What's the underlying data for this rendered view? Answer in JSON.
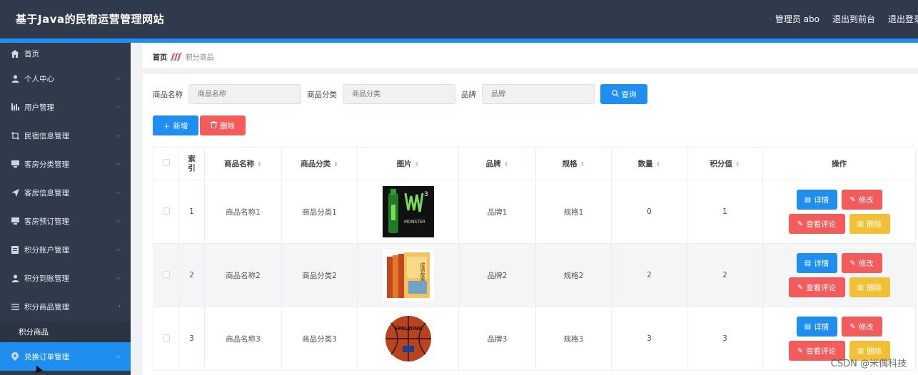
{
  "app": {
    "title": "基于Java的民宿运营管理网站",
    "user_label": "管理员 abo",
    "back_front": "退出到前台",
    "logout": "退出登录"
  },
  "sidebar": {
    "items": [
      {
        "label": "首页",
        "icon": "home-icon"
      },
      {
        "label": "个人中心",
        "icon": "user-icon"
      },
      {
        "label": "用户管理",
        "icon": "bar-chart-icon"
      },
      {
        "label": "民宿信息管理",
        "icon": "crop-icon"
      },
      {
        "label": "客房分类管理",
        "icon": "monitor-icon"
      },
      {
        "label": "客房信息管理",
        "icon": "send-icon"
      },
      {
        "label": "客房预订管理",
        "icon": "monitor-icon"
      },
      {
        "label": "积分账户管理",
        "icon": "document-icon"
      },
      {
        "label": "积分到账管理",
        "icon": "user-icon"
      },
      {
        "label": "积分商品管理",
        "icon": "list-icon"
      }
    ],
    "sub_item": "积分商品",
    "active_item": {
      "label": "兑换订单管理",
      "icon": "location-icon"
    }
  },
  "breadcrumb": {
    "home": "首页",
    "current": "积分商品"
  },
  "search": {
    "name_label": "商品名称",
    "name_placeholder": "商品名称",
    "category_label": "商品分类",
    "category_placeholder": "商品分类",
    "brand_label": "品牌",
    "brand_placeholder": "品牌",
    "query_button": "查询"
  },
  "toolbar": {
    "add": "新增",
    "delete": "删除"
  },
  "table": {
    "headers": {
      "index": "索引",
      "name": "商品名称",
      "category": "商品分类",
      "image": "图片",
      "brand": "品牌",
      "spec": "规格",
      "quantity": "数量",
      "points": "积分值",
      "ops": "操作"
    },
    "rows": [
      {
        "index": "1",
        "name": "商品名称1",
        "category": "商品分类1",
        "image": "monster-energy-drink",
        "brand": "品牌1",
        "spec": "规格1",
        "quantity": "0",
        "points": "1"
      },
      {
        "index": "2",
        "name": "商品名称2",
        "category": "商品分类2",
        "image": "idiom-story-books",
        "brand": "品牌2",
        "spec": "规格2",
        "quantity": "2",
        "points": "2"
      },
      {
        "index": "3",
        "name": "商品名称3",
        "category": "商品分类3",
        "image": "spalding-basketball",
        "brand": "品牌3",
        "spec": "规格3",
        "quantity": "3",
        "points": "3"
      }
    ],
    "ops": {
      "detail": "详情",
      "edit": "修改",
      "comments": "查看评论",
      "remove": "删除"
    }
  },
  "image_text": {
    "monster": "MONSTER",
    "book": "成语故事",
    "ball": "SPALDING"
  },
  "watermark": "CSDN @米偶科技",
  "colors": {
    "header_bg": "#2f3a4b",
    "accent": "#1e8ff0",
    "danger": "#f45c5c",
    "warning": "#f2c035"
  }
}
